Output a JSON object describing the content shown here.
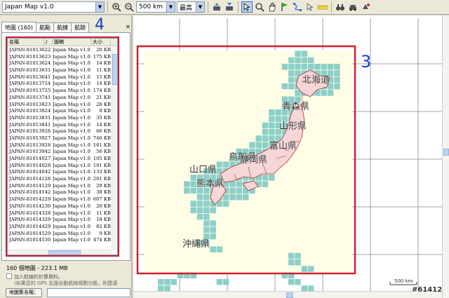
{
  "toolbar": {
    "map_select": "Japan Map v1.0",
    "scale_select": "500 km",
    "quality_select": "最高",
    "icons": [
      "zoom-in-icon",
      "zoom-out-icon",
      "upload-icon",
      "download-icon",
      "select-icon",
      "lasso-icon",
      "pan-hand-icon",
      "flag-icon",
      "route-icon",
      "pointer-icon",
      "ruler-icon",
      "binoculars-icon",
      "car-icon",
      "satellite-icon"
    ]
  },
  "tabs": [
    "地圖 (160)",
    "航點",
    "航線",
    "航跡"
  ],
  "list": {
    "columns": [
      "名稱",
      "/",
      "圖稿",
      "大小"
    ],
    "rows": [
      [
        "JAPAN-81013622",
        "Japan Map v1.0",
        "20 KB"
      ],
      [
        "JAPAN-81013623",
        "Japan Map v1.0",
        "175 KB"
      ],
      [
        "JAPAN-81013624",
        "Japan Map v1.0",
        "14 KB"
      ],
      [
        "JAPAN-81013631",
        "Japan Map v1.0",
        "11 KB"
      ],
      [
        "JAPAN-81013641",
        "Japan Map v1.0",
        "15 KB"
      ],
      [
        "JAPAN-81013724",
        "Japan Map v1.0",
        "14 KB"
      ],
      [
        "JAPAN-81013725",
        "Japan Map v1.0",
        "174 KB"
      ],
      [
        "JAPAN-81013741",
        "Japan Map v1.0",
        "21 KB"
      ],
      [
        "JAPAN-81013823",
        "Japan Map v1.0",
        "28 KB"
      ],
      [
        "JAPAN-81013824",
        "Japan Map v1.0",
        "8 KB"
      ],
      [
        "JAPAN-81013831",
        "Japan Map v1.0",
        "35 KB"
      ],
      [
        "JAPAN-81013841",
        "Japan Map v1.0",
        "14 KB"
      ],
      [
        "JAPAN-81013926",
        "Japan Map v1.0",
        "66 KB"
      ],
      [
        "JAPAN-81013927",
        "Japan Map v1.0",
        "746 KB"
      ],
      [
        "JAPAN-81013928",
        "Japan Map v1.0",
        "161 KB"
      ],
      [
        "JAPAN-81013942",
        "Japan Map v1.0",
        "56 KB"
      ],
      [
        "JAPAN-81014027",
        "Japan Map v1.0",
        "105 KB"
      ],
      [
        "JAPAN-81014028",
        "Japan Map v1.0",
        "191 KB"
      ],
      [
        "JAPAN-81014042",
        "Japan Map v1.0",
        "133 KB"
      ],
      [
        "JAPAN-81014128",
        "Japan Map v1.0",
        "201 KB"
      ],
      [
        "JAPAN-81014129",
        "Japan Map v1.0",
        "29 KB"
      ],
      [
        "JAPAN-81014142",
        "Japan Map v1.0",
        "38 KB"
      ],
      [
        "JAPAN-81014229",
        "Japan Map v1.0",
        "607 KB"
      ],
      [
        "JAPAN-81014230",
        "Japan Map v1.0",
        "20 KB"
      ],
      [
        "JAPAN-81014328",
        "Japan Map v1.0",
        "11 KB"
      ],
      [
        "JAPAN-81014329",
        "Japan Map v1.0",
        "18 KB"
      ],
      [
        "JAPAN-81014429",
        "Japan Map v1.0",
        "82 KB"
      ],
      [
        "JAPAN-81014529",
        "Japan Map v1.0",
        "9 KB"
      ],
      [
        "JAPAN-81014530",
        "Japan Map v1.0",
        "474 KB"
      ]
    ]
  },
  "summary": "160 個地圖 - 223.1 MB",
  "checkbox_label": "加入航線的計算資料。",
  "checkbox_note": "(如果您的 GPS 支援自動航線規劃功能，則建議",
  "name_button": "地圖集名稱：",
  "callout_left": "4",
  "callout_map": "3",
  "map": {
    "labels": [
      "北海道",
      "青森県",
      "山形県",
      "富山県",
      "鳥取県",
      "静岡県",
      "山口県",
      "熊本県",
      "沖縄県"
    ],
    "scale_label": "500 km",
    "colors": {
      "tile": "#8ccfc9",
      "land": "#f7d6d8",
      "paper": "#fffde6",
      "grid": "#888888",
      "border": "#b03030"
    }
  },
  "watermark": "#61412"
}
